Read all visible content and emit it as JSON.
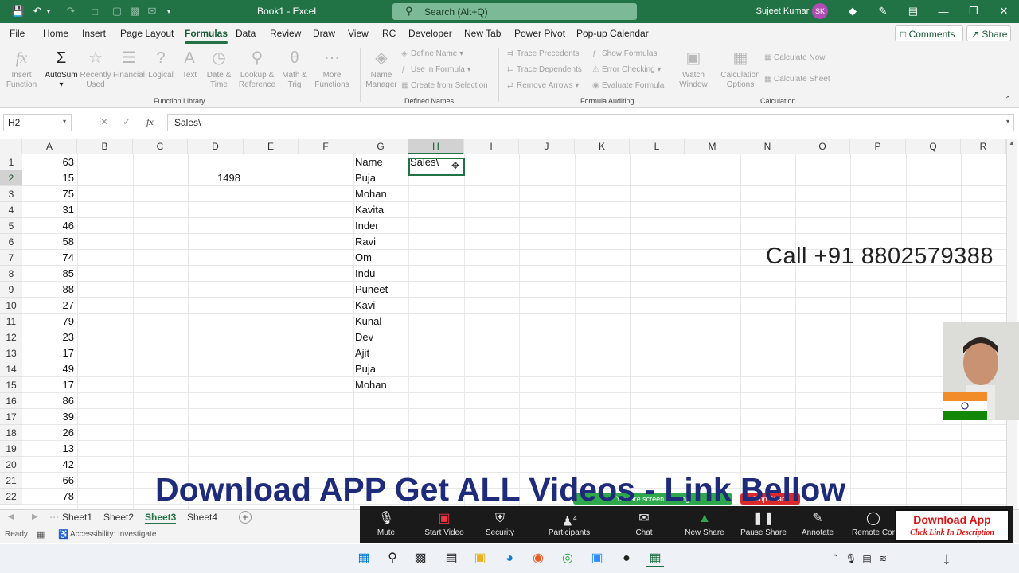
{
  "titlebar": {
    "doc_title": "Book1  -  Excel",
    "search_placeholder": "Search (Alt+Q)",
    "user_name": "Sujeet Kumar",
    "user_initials": "SK",
    "accent": "#217346"
  },
  "menu": {
    "tabs": [
      "File",
      "Home",
      "Insert",
      "Page Layout",
      "Formulas",
      "Data",
      "Review",
      "Draw",
      "View",
      "RC",
      "Developer",
      "New Tab",
      "Power Pivot",
      "Pop-up Calendar"
    ],
    "active": "Formulas",
    "comments": "Comments",
    "share": "Share"
  },
  "ribbon": {
    "function_library": {
      "insert_function": "Insert Function",
      "autosum": "AutoSum",
      "recently_used": "Recently Used",
      "financial": "Financial",
      "logical": "Logical",
      "text": "Text",
      "date_time": "Date & Time",
      "lookup_reference": "Lookup & Reference",
      "math_trig": "Math & Trig",
      "more_functions": "More Functions",
      "group_label": "Function Library"
    },
    "defined_names": {
      "name_manager": "Name Manager",
      "define_name": "Define Name",
      "use_in_formula": "Use in Formula",
      "create_from_selection": "Create from Selection",
      "group_label": "Defined Names"
    },
    "formula_auditing": {
      "trace_precedents": "Trace Precedents",
      "trace_dependents": "Trace Dependents",
      "remove_arrows": "Remove Arrows",
      "show_formulas": "Show Formulas",
      "error_checking": "Error Checking",
      "evaluate_formula": "Evaluate Formula",
      "watch_window": "Watch Window",
      "group_label": "Formula Auditing"
    },
    "calculation": {
      "calculation_options": "Calculation Options",
      "calculate_now": "Calculate Now",
      "calculate_sheet": "Calculate Sheet",
      "group_label": "Calculation"
    }
  },
  "formula_bar": {
    "name_box": "H2",
    "fx": "fx",
    "content": "Sales\\"
  },
  "grid": {
    "columns": [
      "A",
      "B",
      "C",
      "D",
      "E",
      "F",
      "G",
      "H",
      "I",
      "J",
      "K",
      "L",
      "M",
      "N",
      "O",
      "P",
      "Q",
      "R"
    ],
    "rows": [
      "1",
      "2",
      "3",
      "4",
      "5",
      "6",
      "7",
      "8",
      "9",
      "10",
      "11",
      "12",
      "13",
      "14",
      "15",
      "16",
      "17",
      "18",
      "19",
      "20",
      "21",
      "22"
    ],
    "selected_column": "H",
    "selected_row": "2",
    "col_a_values": [
      "63",
      "15",
      "75",
      "31",
      "46",
      "58",
      "74",
      "85",
      "88",
      "27",
      "79",
      "23",
      "17",
      "49",
      "17",
      "86",
      "39",
      "26",
      "13",
      "42",
      "66",
      "78"
    ],
    "d2_value": "1498",
    "col_g_values": [
      "Name",
      "Puja",
      "Mohan",
      "Kavita",
      "Inder",
      "Ravi",
      "Om",
      "Indu",
      "Puneet",
      "Kavi",
      "Kunal",
      "Dev",
      "Ajit",
      "Puja",
      "Mohan"
    ],
    "h1_value": "Sales\\"
  },
  "overlay": {
    "phone": "Call +91 8802579388",
    "banner": "Download APP Get ALL Videos - Link Bellow",
    "download_app": "Download App",
    "click_link": "Click Link In Description"
  },
  "sheets": {
    "tabs": [
      "Sheet1",
      "Sheet2",
      "Sheet3",
      "Sheet4"
    ],
    "active": "Sheet3"
  },
  "status": {
    "ready": "Ready",
    "accessibility": "Accessibility: Investigate"
  },
  "zoom_controls": {
    "mute": "Mute",
    "start_video": "Start Video",
    "security": "Security",
    "participants": "Participants",
    "participants_count": "4",
    "chat": "Chat",
    "new_share": "New Share",
    "pause_share": "Pause Share",
    "annotate": "Annotate",
    "remote_control": "Remote Cor",
    "sharing_notice": "You are screen sharing",
    "stop_share": "Stop Share"
  }
}
